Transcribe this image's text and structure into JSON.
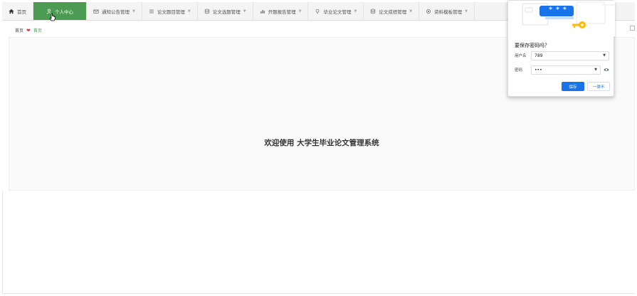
{
  "nav": {
    "items": [
      {
        "label": "首页",
        "icon": "home-icon"
      },
      {
        "label": "个人中心",
        "icon": "user-icon",
        "active": true
      },
      {
        "label": "通知公告管理",
        "icon": "envelope-icon"
      },
      {
        "label": "论文题目管理",
        "icon": "list-icon"
      },
      {
        "label": "论文选题管理",
        "icon": "database-icon"
      },
      {
        "label": "开题报告管理",
        "icon": "chart-icon"
      },
      {
        "label": "毕业论文管理",
        "icon": "pin-icon"
      },
      {
        "label": "论文成绩管理",
        "icon": "database-icon"
      },
      {
        "label": "资料模板管理",
        "icon": "gear-icon"
      }
    ]
  },
  "breadcrumb": {
    "home": "首页",
    "current": "首页"
  },
  "main": {
    "welcome": "欢迎使用 大学生毕业论文管理系统"
  },
  "password_popup": {
    "title": "要保存密码吗？",
    "username_label": "用户名",
    "username_value": "789",
    "password_label": "密码",
    "password_value": "•••",
    "save_label": "保存",
    "never_label": "一律不",
    "masked_display": "* * *"
  },
  "colors": {
    "active_nav": "#4c9b52",
    "save_button": "#1a73e8",
    "heart": "#d9364a"
  }
}
